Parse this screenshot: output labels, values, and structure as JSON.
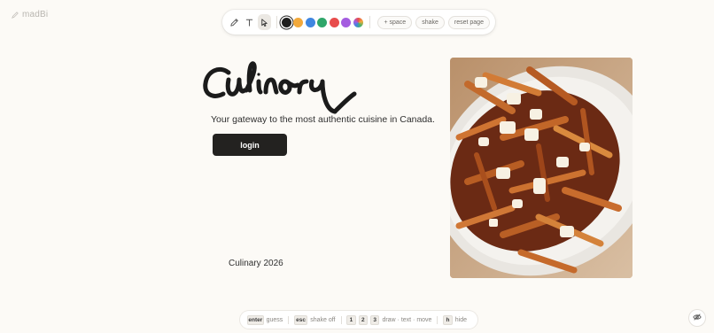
{
  "brand": {
    "name": "madBi",
    "icon": "pencil-icon"
  },
  "toolbar": {
    "tools": [
      {
        "name": "pen",
        "icon": "pencil-icon",
        "active": false
      },
      {
        "name": "text",
        "icon": "text-icon",
        "active": false
      },
      {
        "name": "select",
        "icon": "cursor-icon",
        "active": true
      }
    ],
    "colors": [
      {
        "name": "black",
        "hex": "#1f1f1f",
        "selected": true
      },
      {
        "name": "orange",
        "hex": "#f2a93b",
        "selected": false
      },
      {
        "name": "blue",
        "hex": "#3f86e0",
        "selected": false
      },
      {
        "name": "green",
        "hex": "#2fa66a",
        "selected": false
      },
      {
        "name": "red",
        "hex": "#e84c4c",
        "selected": false
      },
      {
        "name": "purple",
        "hex": "#a45ce0",
        "selected": false
      },
      {
        "name": "multicolor",
        "hex": "",
        "selected": false
      }
    ],
    "space_label": "+ space",
    "shake_label": "shake",
    "reset_label": "reset page"
  },
  "hero": {
    "logo_text": "Culinary",
    "tagline": "Your gateway to the most authentic cuisine in Canada.",
    "login_label": "login",
    "copyright": "Culinary 2026"
  },
  "photo": {
    "subject": "poutine"
  },
  "hints": {
    "enter_key": "enter",
    "enter_label": "guess",
    "esc_key": "esc",
    "esc_label": "shake off",
    "key_1": "1",
    "key_2": "2",
    "key_3": "3",
    "modes_label": "draw · text · move",
    "h_key": "h",
    "h_label": "hide"
  },
  "corner_button": {
    "icon": "eye-off-icon"
  },
  "colors": {
    "background": "#fcfaf6",
    "button_dark": "#232220"
  }
}
